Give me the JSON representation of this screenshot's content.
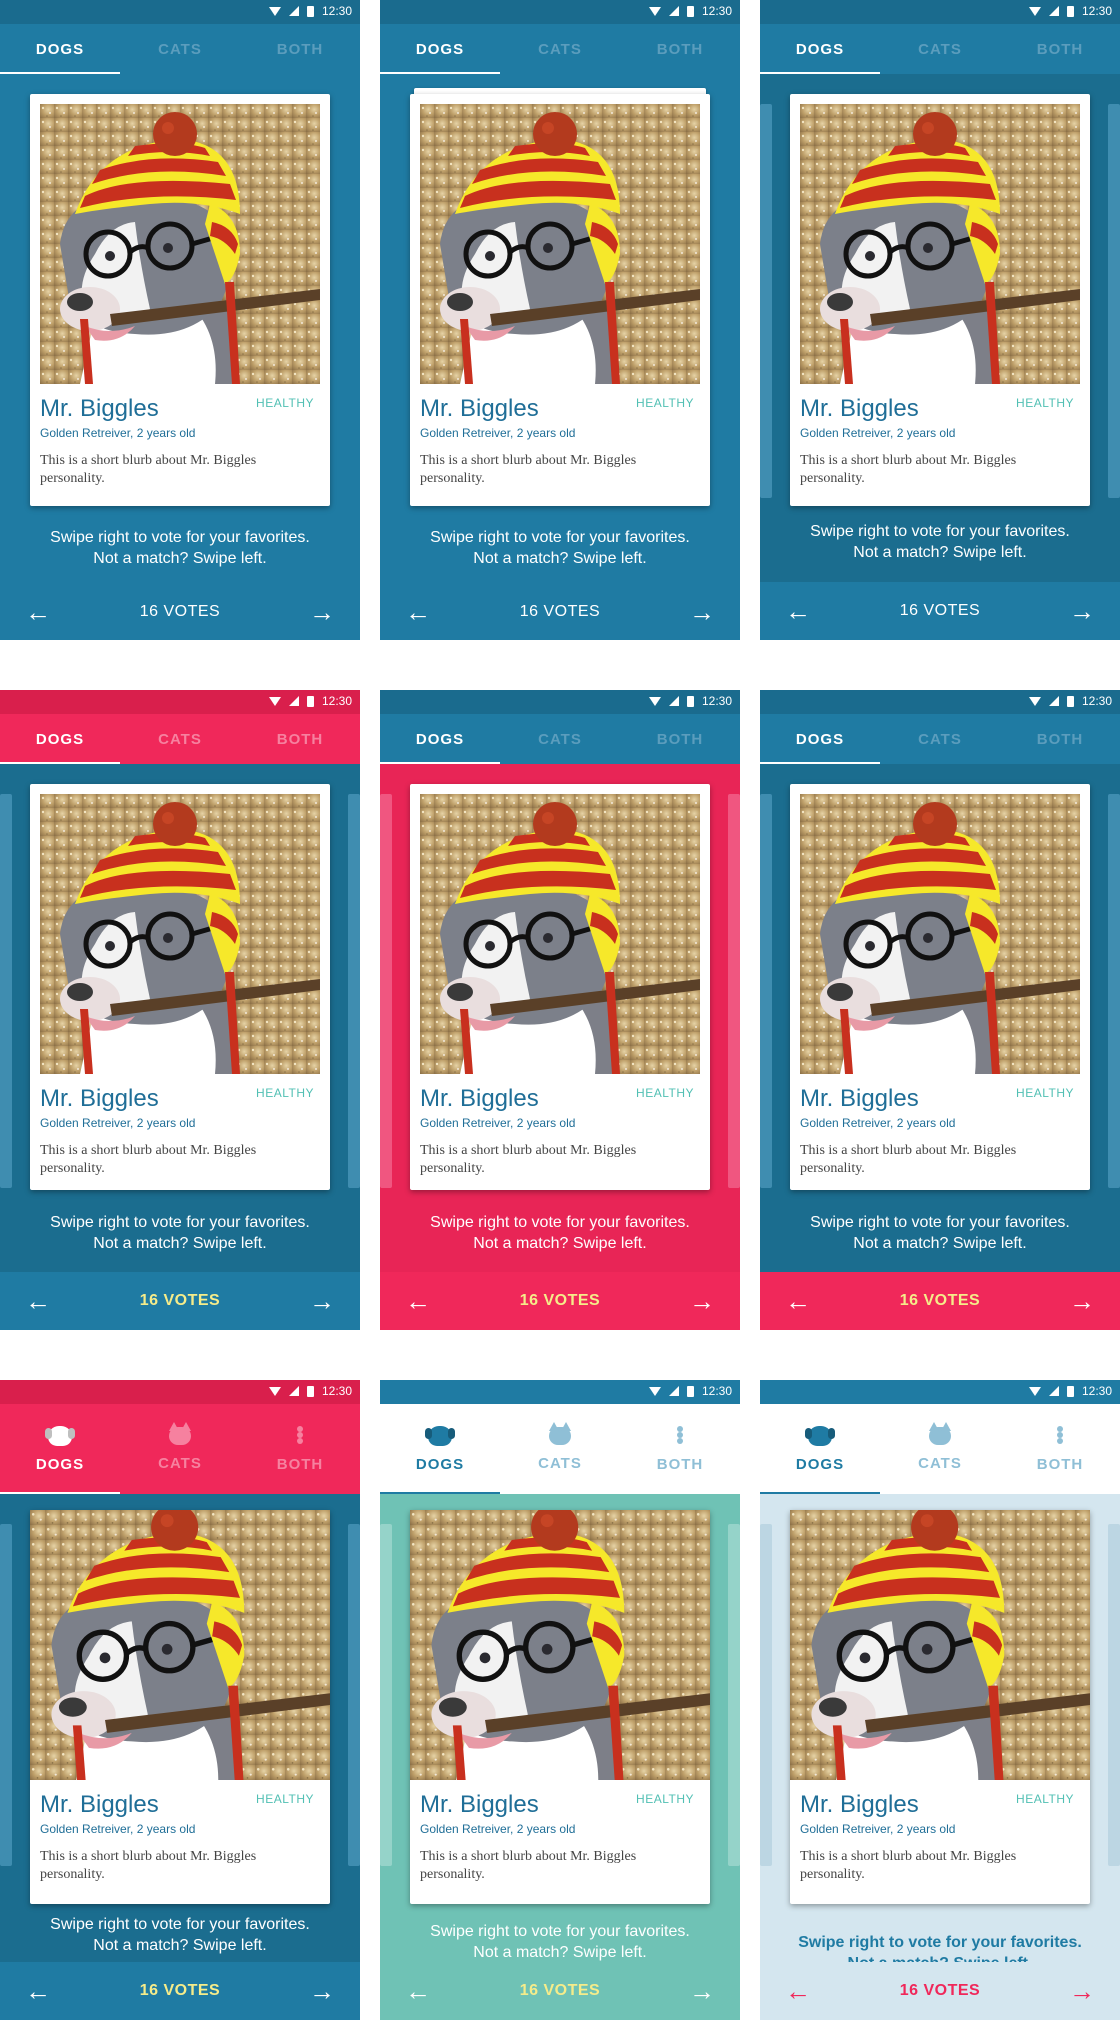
{
  "status": {
    "time": "12:30"
  },
  "tabs": [
    "DOGS",
    "CATS",
    "BOTH"
  ],
  "card": {
    "name": "Mr. Biggles",
    "status": "HEALTHY",
    "breed": "Golden Retreiver, 2 years old",
    "blurb": "This is a short blurb about Mr. Biggles personality."
  },
  "hint": {
    "line1": "Swipe right to vote for your favorites.",
    "line2": "Not a match? Swipe left."
  },
  "footer": {
    "votes": "16 VOTES",
    "prev_icon": "arrow-left-icon",
    "next_icon": "arrow-right-icon"
  },
  "tab_icons": [
    "dog-icon",
    "cat-icon",
    "more-dots-icon"
  ],
  "colors": {
    "blue": "#1f7ba3",
    "blue_dark": "#1b6d8f",
    "blue_status": "#1a6b8e",
    "pink": "#f0285a",
    "pink_dark": "#d91f4c",
    "teal": "#6fc2b5",
    "light_blue_bg": "#d4e6ef",
    "yellow": "#f5ec8a",
    "white": "#ffffff"
  },
  "screens": [
    {
      "id": "a",
      "variant": "standard"
    },
    {
      "id": "b",
      "variant": "stacked"
    },
    {
      "id": "c",
      "variant": "peek"
    },
    {
      "id": "d",
      "variant": "pink-header"
    },
    {
      "id": "e",
      "variant": "pink-content"
    },
    {
      "id": "f",
      "variant": "pink-footer"
    },
    {
      "id": "g",
      "variant": "pink-icon-tabs"
    },
    {
      "id": "h",
      "variant": "teal-icon-tabs"
    },
    {
      "id": "i",
      "variant": "light-icon-tabs"
    }
  ]
}
